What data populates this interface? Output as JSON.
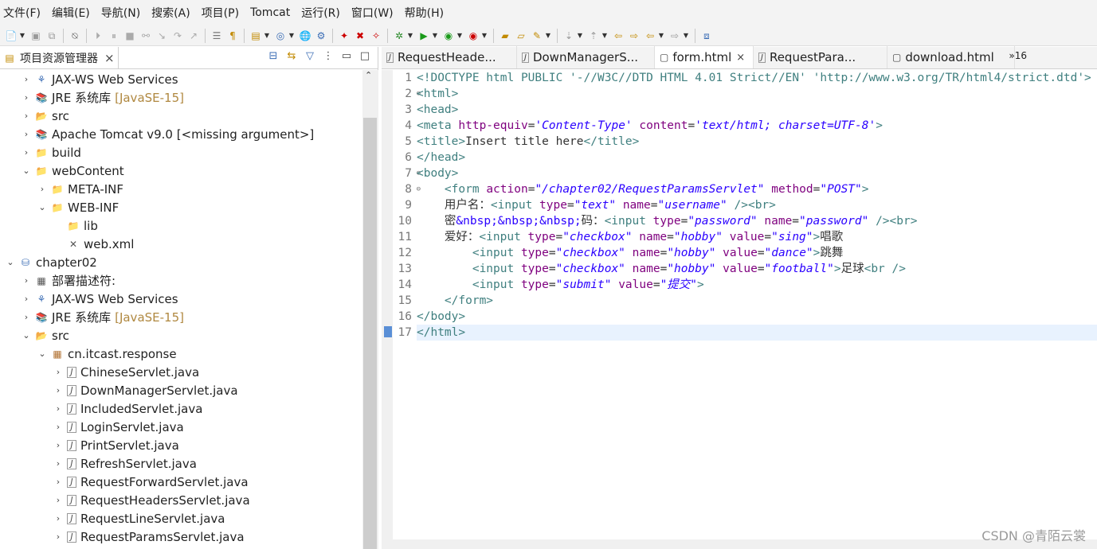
{
  "menubar": {
    "items": [
      "文件(F)",
      "编辑(E)",
      "导航(N)",
      "搜索(A)",
      "项目(P)",
      "Tomcat",
      "运行(R)",
      "窗口(W)",
      "帮助(H)"
    ]
  },
  "explorer": {
    "title": "项目资源管理器",
    "tree": [
      {
        "label": "JAX-WS Web Services",
        "level": 1,
        "expanded": false,
        "icon": "web-services-icon"
      },
      {
        "label": "JRE 系统库",
        "deco": "[JavaSE-15]",
        "level": 1,
        "expanded": false,
        "icon": "library-icon"
      },
      {
        "label": "src",
        "level": 1,
        "expanded": false,
        "icon": "source-folder-icon"
      },
      {
        "label": "Apache Tomcat v9.0 [<missing argument>]",
        "level": 1,
        "expanded": false,
        "icon": "library-icon"
      },
      {
        "label": "build",
        "level": 1,
        "expanded": false,
        "icon": "folder-icon"
      },
      {
        "label": "webContent",
        "level": 1,
        "expanded": true,
        "icon": "folder-icon"
      },
      {
        "label": "META-INF",
        "level": 2,
        "expanded": false,
        "icon": "folder-icon"
      },
      {
        "label": "WEB-INF",
        "level": 2,
        "expanded": true,
        "icon": "folder-icon"
      },
      {
        "label": "lib",
        "level": 3,
        "leaf": true,
        "icon": "folder-icon"
      },
      {
        "label": "web.xml",
        "level": 3,
        "leaf": true,
        "icon": "xml-file-icon"
      },
      {
        "label": "chapter02",
        "level": 0,
        "expanded": true,
        "icon": "project-icon"
      },
      {
        "label": "部署描述符:",
        "level": 1,
        "expanded": false,
        "icon": "deployment-descriptor-icon"
      },
      {
        "label": "JAX-WS Web Services",
        "level": 1,
        "expanded": false,
        "icon": "web-services-icon"
      },
      {
        "label": "JRE 系统库",
        "deco": "[JavaSE-15]",
        "level": 1,
        "expanded": false,
        "icon": "library-icon"
      },
      {
        "label": "src",
        "level": 1,
        "expanded": true,
        "icon": "source-folder-icon"
      },
      {
        "label": "cn.itcast.response",
        "level": 2,
        "expanded": true,
        "icon": "package-icon"
      },
      {
        "label": "ChineseServlet.java",
        "level": 3,
        "expanded": false,
        "icon": "java-file-icon"
      },
      {
        "label": "DownManagerServlet.java",
        "level": 3,
        "expanded": false,
        "icon": "java-file-icon"
      },
      {
        "label": "IncludedServlet.java",
        "level": 3,
        "expanded": false,
        "icon": "java-file-icon"
      },
      {
        "label": "LoginServlet.java",
        "level": 3,
        "expanded": false,
        "icon": "java-file-icon"
      },
      {
        "label": "PrintServlet.java",
        "level": 3,
        "expanded": false,
        "icon": "java-file-icon"
      },
      {
        "label": "RefreshServlet.java",
        "level": 3,
        "expanded": false,
        "icon": "java-file-icon"
      },
      {
        "label": "RequestForwardServlet.java",
        "level": 3,
        "expanded": false,
        "icon": "java-file-icon"
      },
      {
        "label": "RequestHeadersServlet.java",
        "level": 3,
        "expanded": false,
        "icon": "java-file-icon"
      },
      {
        "label": "RequestLineServlet.java",
        "level": 3,
        "expanded": false,
        "icon": "java-file-icon"
      },
      {
        "label": "RequestParamsServlet.java",
        "level": 3,
        "expanded": false,
        "icon": "java-file-icon"
      }
    ]
  },
  "editor": {
    "tabs": [
      {
        "label": "RequestHeade...",
        "icon": "java-file-icon",
        "active": false
      },
      {
        "label": "DownManagerS...",
        "icon": "java-file-icon",
        "active": false
      },
      {
        "label": "form.html",
        "icon": "html-file-icon",
        "active": true
      },
      {
        "label": "RequestPara...",
        "icon": "java-file-icon",
        "active": false
      },
      {
        "label": "download.html",
        "icon": "html-file-icon",
        "active": false
      }
    ],
    "tab_overflow": "»16",
    "current_line": 17,
    "lines": [
      {
        "n": "1",
        "fold": "",
        "tokens": [
          [
            "t",
            "<!DOCTYPE html PUBLIC '-//W3C//DTD HTML 4.01 Strict//EN' 'http://www.w3.org/TR/html4/strict.dtd'>"
          ]
        ]
      },
      {
        "n": "2",
        "fold": "⊖",
        "tokens": [
          [
            "t",
            "<html>"
          ]
        ]
      },
      {
        "n": "3",
        "fold": "",
        "tokens": [
          [
            "t",
            "<head>"
          ]
        ]
      },
      {
        "n": "4",
        "fold": "",
        "tokens": [
          [
            "t",
            "<meta "
          ],
          [
            "a",
            "http-equiv"
          ],
          [
            "e",
            "="
          ],
          [
            "v",
            "'Content-Type'"
          ],
          [
            "e",
            " "
          ],
          [
            "a",
            "content"
          ],
          [
            "e",
            "="
          ],
          [
            "v",
            "'text/html; charset=UTF-8'"
          ],
          [
            "t",
            ">"
          ]
        ]
      },
      {
        "n": "5",
        "fold": "",
        "tokens": [
          [
            "t",
            "<title>"
          ],
          [
            "e",
            "Insert title here"
          ],
          [
            "t",
            "</title>"
          ]
        ]
      },
      {
        "n": "6",
        "fold": "",
        "tokens": [
          [
            "t",
            "</head>"
          ]
        ]
      },
      {
        "n": "7",
        "fold": "⊖",
        "tokens": [
          [
            "t",
            "<body>"
          ]
        ]
      },
      {
        "n": "8",
        "fold": "⊖",
        "tokens": [
          [
            "e",
            "    "
          ],
          [
            "t",
            "<form "
          ],
          [
            "a",
            "action"
          ],
          [
            "e",
            "="
          ],
          [
            "v",
            "\"/chapter02/RequestParamsServlet\""
          ],
          [
            "e",
            " "
          ],
          [
            "a",
            "method"
          ],
          [
            "e",
            "="
          ],
          [
            "v",
            "\"POST\""
          ],
          [
            "t",
            ">"
          ]
        ]
      },
      {
        "n": "9",
        "fold": "",
        "tokens": [
          [
            "e",
            "    用户名："
          ],
          [
            "t",
            "<input "
          ],
          [
            "a",
            "type"
          ],
          [
            "e",
            "="
          ],
          [
            "v",
            "\"text\""
          ],
          [
            "e",
            " "
          ],
          [
            "a",
            "name"
          ],
          [
            "e",
            "="
          ],
          [
            "v",
            "\"username\""
          ],
          [
            "e",
            " "
          ],
          [
            "t",
            "/><br>"
          ]
        ]
      },
      {
        "n": "10",
        "fold": "",
        "tokens": [
          [
            "e",
            "    密"
          ],
          [
            "s",
            "&nbsp;&nbsp;&nbsp;"
          ],
          [
            "e",
            "码："
          ],
          [
            "t",
            "<input "
          ],
          [
            "a",
            "type"
          ],
          [
            "e",
            "="
          ],
          [
            "v",
            "\"password\""
          ],
          [
            "e",
            " "
          ],
          [
            "a",
            "name"
          ],
          [
            "e",
            "="
          ],
          [
            "v",
            "\"password\""
          ],
          [
            "e",
            " "
          ],
          [
            "t",
            "/><br>"
          ]
        ]
      },
      {
        "n": "11",
        "fold": "",
        "tokens": [
          [
            "e",
            "    爱好："
          ],
          [
            "t",
            "<input "
          ],
          [
            "a",
            "type"
          ],
          [
            "e",
            "="
          ],
          [
            "v",
            "\"checkbox\""
          ],
          [
            "e",
            " "
          ],
          [
            "a",
            "name"
          ],
          [
            "e",
            "="
          ],
          [
            "v",
            "\"hobby\""
          ],
          [
            "e",
            " "
          ],
          [
            "a",
            "value"
          ],
          [
            "e",
            "="
          ],
          [
            "v",
            "\"sing\""
          ],
          [
            "t",
            ">"
          ],
          [
            "e",
            "唱歌"
          ]
        ]
      },
      {
        "n": "12",
        "fold": "",
        "tokens": [
          [
            "e",
            "        "
          ],
          [
            "t",
            "<input "
          ],
          [
            "a",
            "type"
          ],
          [
            "e",
            "="
          ],
          [
            "v",
            "\"checkbox\""
          ],
          [
            "e",
            " "
          ],
          [
            "a",
            "name"
          ],
          [
            "e",
            "="
          ],
          [
            "v",
            "\"hobby\""
          ],
          [
            "e",
            " "
          ],
          [
            "a",
            "value"
          ],
          [
            "e",
            "="
          ],
          [
            "v",
            "\"dance\""
          ],
          [
            "t",
            ">"
          ],
          [
            "e",
            "跳舞"
          ]
        ]
      },
      {
        "n": "13",
        "fold": "",
        "tokens": [
          [
            "e",
            "        "
          ],
          [
            "t",
            "<input "
          ],
          [
            "a",
            "type"
          ],
          [
            "e",
            "="
          ],
          [
            "v",
            "\"checkbox\""
          ],
          [
            "e",
            " "
          ],
          [
            "a",
            "name"
          ],
          [
            "e",
            "="
          ],
          [
            "v",
            "\"hobby\""
          ],
          [
            "e",
            " "
          ],
          [
            "a",
            "value"
          ],
          [
            "e",
            "="
          ],
          [
            "v",
            "\"football\""
          ],
          [
            "t",
            ">"
          ],
          [
            "e",
            "足球"
          ],
          [
            "t",
            "<br />"
          ]
        ]
      },
      {
        "n": "14",
        "fold": "",
        "tokens": [
          [
            "e",
            "        "
          ],
          [
            "t",
            "<input "
          ],
          [
            "a",
            "type"
          ],
          [
            "e",
            "="
          ],
          [
            "v",
            "\"submit\""
          ],
          [
            "e",
            " "
          ],
          [
            "a",
            "value"
          ],
          [
            "e",
            "="
          ],
          [
            "v",
            "\"提交\""
          ],
          [
            "t",
            ">"
          ]
        ]
      },
      {
        "n": "15",
        "fold": "",
        "tokens": [
          [
            "e",
            "    "
          ],
          [
            "t",
            "</form>"
          ]
        ]
      },
      {
        "n": "16",
        "fold": "",
        "tokens": [
          [
            "t",
            "</body>"
          ]
        ]
      },
      {
        "n": "17",
        "fold": "",
        "tokens": [
          [
            "t",
            "</html>"
          ]
        ]
      }
    ]
  },
  "watermark": "CSDN @青陌云裳",
  "colors": {
    "tag": "#3f7f7f",
    "attribute": "#7f007f",
    "value": "#2a00ff",
    "current_line": "#e8f2fe"
  }
}
